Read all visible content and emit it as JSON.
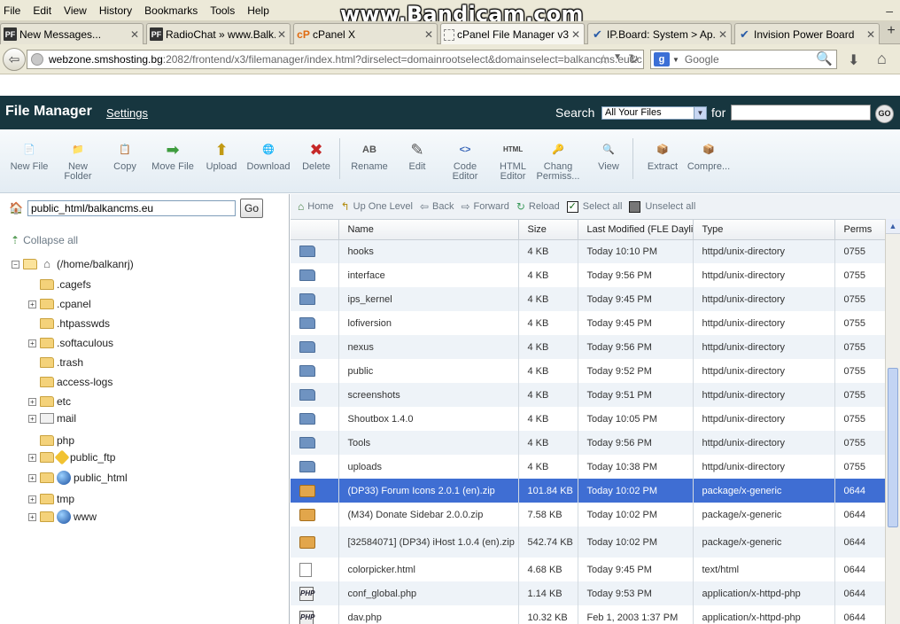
{
  "browser": {
    "menu": [
      "File",
      "Edit",
      "View",
      "History",
      "Bookmarks",
      "Tools",
      "Help"
    ],
    "watermark": "www.Bandicam.com",
    "tabs": [
      {
        "label": "New Messages...",
        "icon": "PF"
      },
      {
        "label": "RadioChat » www.Balk...",
        "icon": "PF"
      },
      {
        "label": "cPanel X",
        "icon": "cP"
      },
      {
        "label": "cPanel File Manager v3",
        "icon": "blank"
      },
      {
        "label": "IP.Board: System > Ap...",
        "icon": "ipb"
      },
      {
        "label": "Invision Power Board",
        "icon": "ipb"
      }
    ],
    "url_domain": "webzone.smshosting.bg",
    "url_rest": ":2082/frontend/x3/filemanager/index.html?dirselect=domainrootselect&domainselect=balkancms.eu&c",
    "search_placeholder": "Google"
  },
  "header": {
    "title": "File Manager",
    "settings": "Settings",
    "search_label": "Search",
    "search_scope": "All Your Files",
    "for_label": "for",
    "go": "GO"
  },
  "toolbar": [
    {
      "label": "New File",
      "icon": "new-file-icon",
      "glyph": "📄"
    },
    {
      "label": "New Folder",
      "icon": "new-folder-icon",
      "glyph": "📁"
    },
    {
      "label": "Copy",
      "icon": "copy-icon",
      "glyph": "📋"
    },
    {
      "label": "Move File",
      "icon": "move-file-icon",
      "glyph": "➡"
    },
    {
      "label": "Upload",
      "icon": "upload-icon",
      "glyph": "⬆"
    },
    {
      "label": "Download",
      "icon": "download-icon",
      "glyph": "🌐"
    },
    {
      "label": "Delete",
      "icon": "delete-icon",
      "glyph": "✖"
    },
    {
      "label": "Rename",
      "icon": "rename-icon",
      "glyph": "AB"
    },
    {
      "label": "Edit",
      "icon": "edit-icon",
      "glyph": "✎"
    },
    {
      "label": "Code Editor",
      "icon": "code-editor-icon",
      "glyph": "<>"
    },
    {
      "label": "HTML Editor",
      "icon": "html-editor-icon",
      "glyph": "HTML"
    },
    {
      "label": "Chang Permiss...",
      "icon": "permissions-icon",
      "glyph": "🔑"
    },
    {
      "label": "View",
      "icon": "view-icon",
      "glyph": "🔍"
    },
    {
      "label": "Extract",
      "icon": "extract-icon",
      "glyph": "📦"
    },
    {
      "label": "Compre...",
      "icon": "compress-icon",
      "glyph": "📦"
    }
  ],
  "left": {
    "path": "public_html/balkancms.eu",
    "go": "Go",
    "collapse_all": "Collapse all",
    "root": "(/home/balkanrj)",
    "tree": [
      {
        "label": ".cagefs",
        "expander": "",
        "icon": "folder"
      },
      {
        "label": ".cpanel",
        "expander": "+",
        "icon": "folder"
      },
      {
        "label": ".htpasswds",
        "expander": "",
        "icon": "folder"
      },
      {
        "label": ".softaculous",
        "expander": "+",
        "icon": "folder"
      },
      {
        "label": ".trash",
        "expander": "",
        "icon": "folder"
      },
      {
        "label": "access-logs",
        "expander": "",
        "icon": "folder"
      },
      {
        "label": "etc",
        "expander": "+",
        "icon": "folder"
      },
      {
        "label": "mail",
        "expander": "+",
        "icon": "mail"
      },
      {
        "label": "php",
        "expander": "",
        "icon": "folder"
      },
      {
        "label": "public_ftp",
        "expander": "+",
        "icon": "warn"
      },
      {
        "label": "public_html",
        "expander": "+",
        "icon": "globe"
      },
      {
        "label": "tmp",
        "expander": "+",
        "icon": "folder"
      },
      {
        "label": "www",
        "expander": "+",
        "icon": "globe"
      }
    ]
  },
  "nav": {
    "home": "Home",
    "up": "Up One Level",
    "back": "Back",
    "forward": "Forward",
    "reload": "Reload",
    "select_all": "Select all",
    "unselect_all": "Unselect all"
  },
  "table": {
    "headers": [
      "Name",
      "Size",
      "Last Modified (FLE Daylig",
      "Type",
      "Perms"
    ],
    "rows": [
      {
        "kind": "dir",
        "name": "hooks",
        "size": "4 KB",
        "modified": "Today 10:10 PM",
        "type": "httpd/unix-directory",
        "perms": "0755"
      },
      {
        "kind": "dir",
        "name": "interface",
        "size": "4 KB",
        "modified": "Today 9:56 PM",
        "type": "httpd/unix-directory",
        "perms": "0755"
      },
      {
        "kind": "dir",
        "name": "ips_kernel",
        "size": "4 KB",
        "modified": "Today 9:45 PM",
        "type": "httpd/unix-directory",
        "perms": "0755"
      },
      {
        "kind": "dir",
        "name": "lofiversion",
        "size": "4 KB",
        "modified": "Today 9:45 PM",
        "type": "httpd/unix-directory",
        "perms": "0755"
      },
      {
        "kind": "dir",
        "name": "nexus",
        "size": "4 KB",
        "modified": "Today 9:56 PM",
        "type": "httpd/unix-directory",
        "perms": "0755"
      },
      {
        "kind": "dir",
        "name": "public",
        "size": "4 KB",
        "modified": "Today 9:52 PM",
        "type": "httpd/unix-directory",
        "perms": "0755"
      },
      {
        "kind": "dir",
        "name": "screenshots",
        "size": "4 KB",
        "modified": "Today 9:51 PM",
        "type": "httpd/unix-directory",
        "perms": "0755"
      },
      {
        "kind": "dir",
        "name": "Shoutbox 1.4.0",
        "size": "4 KB",
        "modified": "Today 10:05 PM",
        "type": "httpd/unix-directory",
        "perms": "0755"
      },
      {
        "kind": "dir",
        "name": "Tools",
        "size": "4 KB",
        "modified": "Today 9:56 PM",
        "type": "httpd/unix-directory",
        "perms": "0755"
      },
      {
        "kind": "dir",
        "name": "uploads",
        "size": "4 KB",
        "modified": "Today 10:38 PM",
        "type": "httpd/unix-directory",
        "perms": "0755"
      },
      {
        "kind": "pkg",
        "name": "(DP33) Forum Icons 2.0.1 (en).zip",
        "size": "101.84 KB",
        "modified": "Today 10:02 PM",
        "type": "package/x-generic",
        "perms": "0644",
        "selected": true
      },
      {
        "kind": "pkg",
        "name": "(M34) Donate Sidebar 2.0.0.zip",
        "size": "7.58 KB",
        "modified": "Today 10:02 PM",
        "type": "package/x-generic",
        "perms": "0644"
      },
      {
        "kind": "pkg",
        "name": "[32584071] (DP34) iHost 1.0.4 (en).zip",
        "size": "542.74 KB",
        "modified": "Today 10:02 PM",
        "type": "package/x-generic",
        "perms": "0644",
        "tall": true
      },
      {
        "kind": "html",
        "name": "colorpicker.html",
        "size": "4.68 KB",
        "modified": "Today 9:45 PM",
        "type": "text/html",
        "perms": "0644"
      },
      {
        "kind": "php",
        "name": "conf_global.php",
        "size": "1.14 KB",
        "modified": "Today 9:53 PM",
        "type": "application/x-httpd-php",
        "perms": "0644"
      },
      {
        "kind": "php",
        "name": "dav.php",
        "size": "10.32 KB",
        "modified": "Feb 1, 2003 1:37 PM",
        "type": "application/x-httpd-php",
        "perms": "0644"
      }
    ]
  },
  "colors": {
    "header_bg": "#17363f",
    "selection": "#3f6ed3",
    "row_alt": "#eef3f8"
  }
}
